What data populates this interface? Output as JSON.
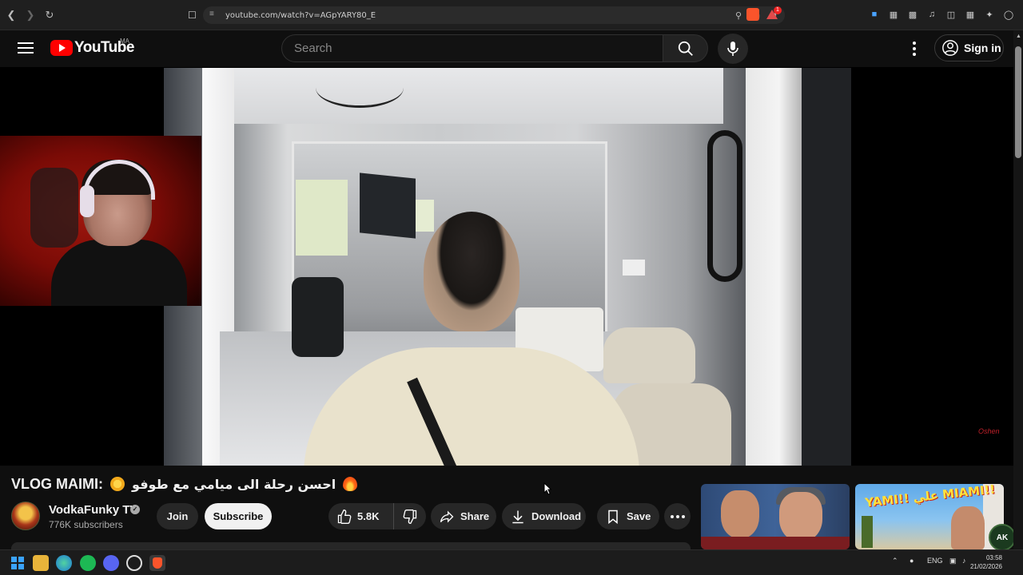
{
  "browser": {
    "url": "youtube.com/watch?v=AGpYARY80_E",
    "brave_badge_count": "1"
  },
  "masthead": {
    "logo_text": "YouTube",
    "country_code": "MA",
    "search_placeholder": "Search",
    "sign_in_label": "Sign in"
  },
  "video": {
    "watermark": "Oshen",
    "title_prefix": "VLOG MAIMI:",
    "title_arabic": "احسن رحلة الى ميامي مع طوفو",
    "channel_name": "VodkaFunky TV",
    "subscribers": "776K subscribers",
    "join_label": "Join",
    "subscribe_label": "Subscribe",
    "like_count": "5.8K",
    "share_label": "Share",
    "download_label": "Download",
    "save_label": "Save"
  },
  "recommendations": [
    {
      "thumb_text": ""
    },
    {
      "thumb_text": "YAMI!! علي MIAMI!!"
    }
  ],
  "taskbar": {
    "language": "ENG",
    "time": "03:58",
    "date": "21/02/2026",
    "corner_logo_text": "AK"
  },
  "colors": {
    "youtube_red": "#ff0000",
    "background": "#0f0f0f",
    "pill_bg": "#272727",
    "subscribe_bg": "#f1f1f1"
  }
}
